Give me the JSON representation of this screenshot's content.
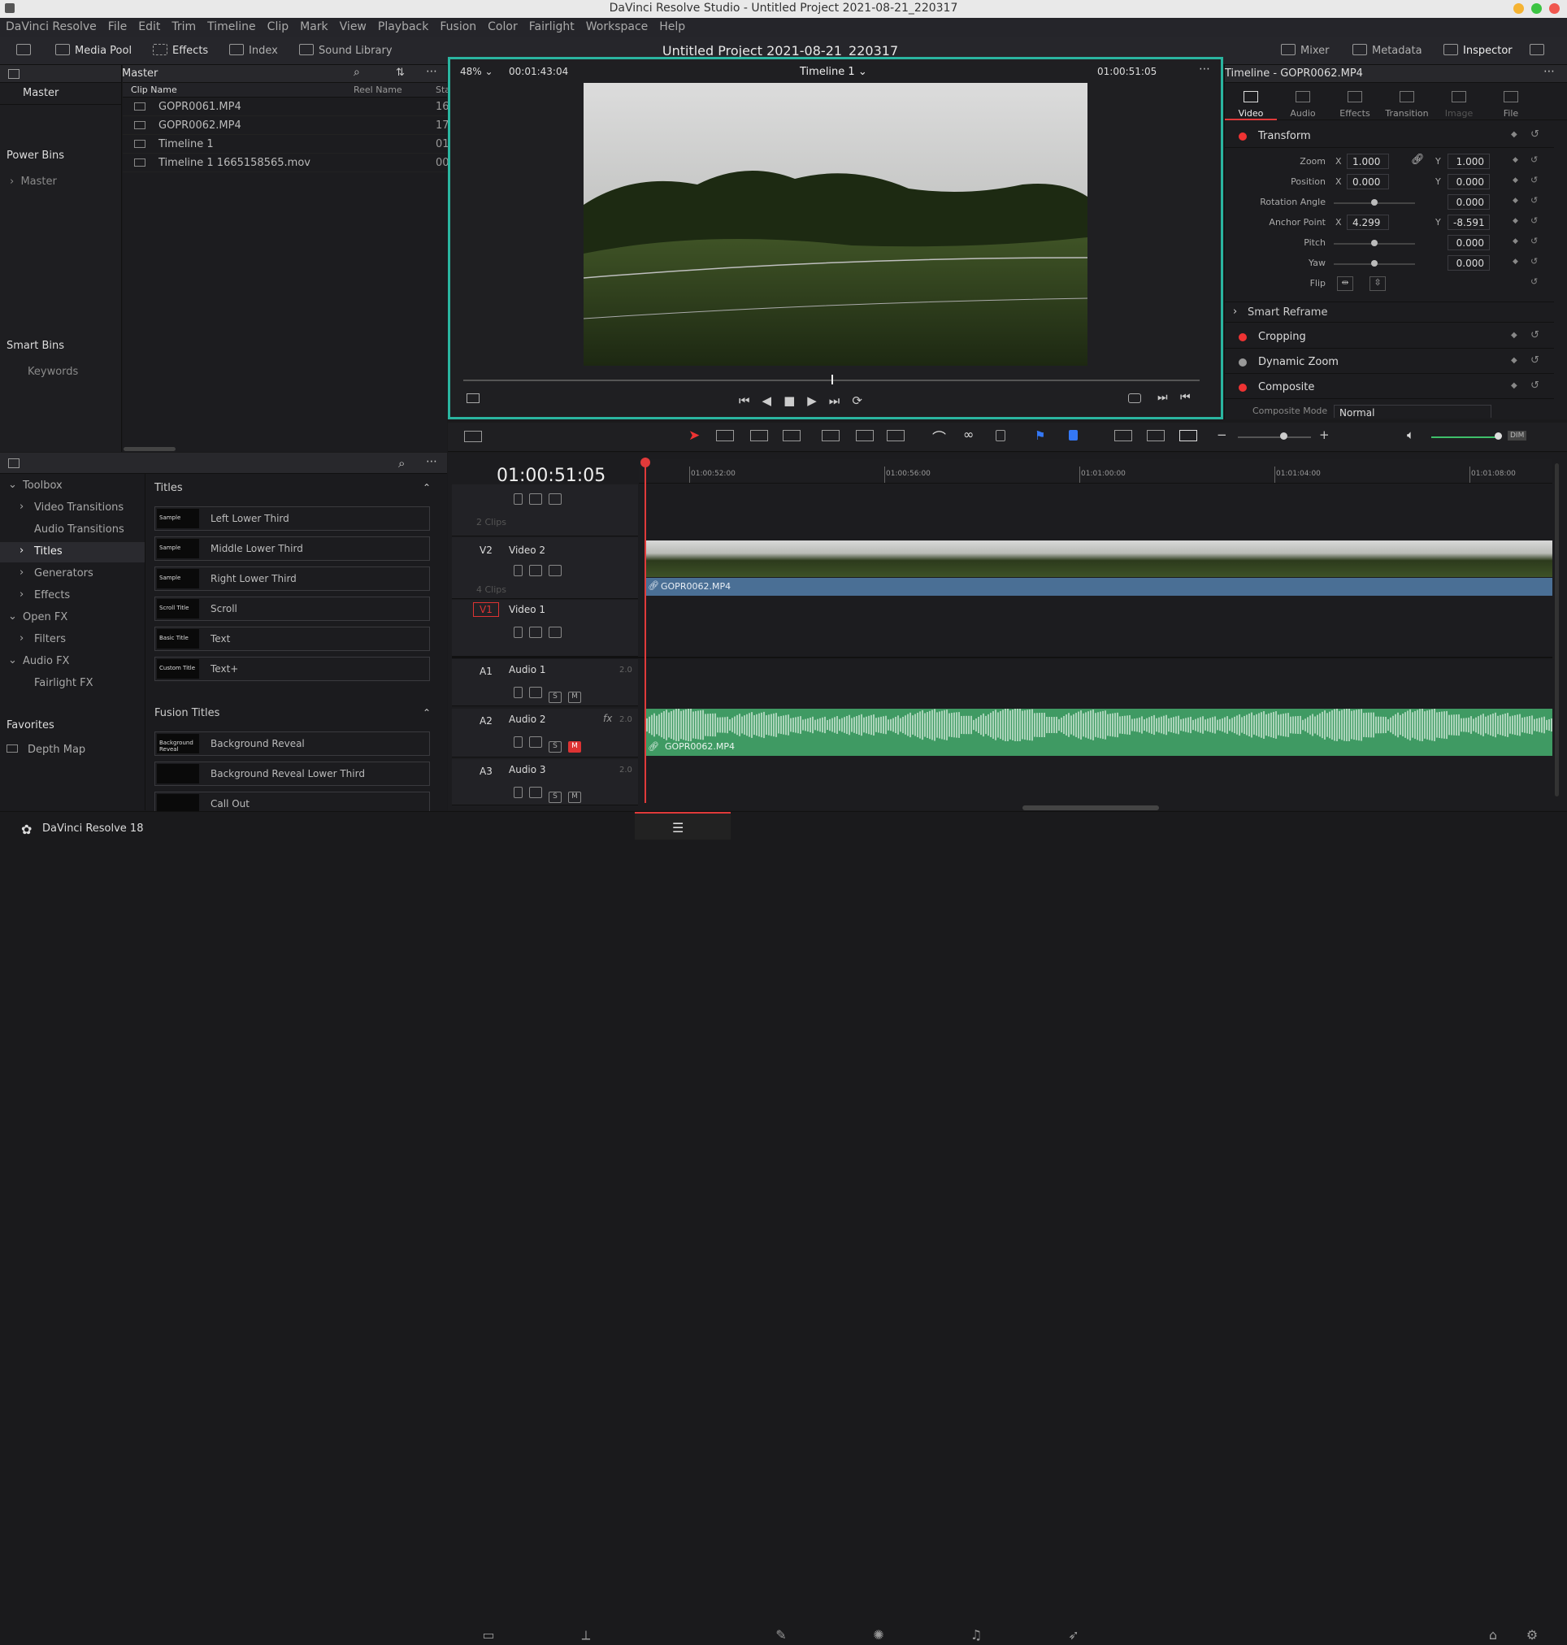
{
  "window": {
    "title": "DaVinci Resolve Studio - Untitled Project 2021-08-21_220317"
  },
  "menu": [
    "DaVinci Resolve",
    "File",
    "Edit",
    "Trim",
    "Timeline",
    "Clip",
    "Mark",
    "View",
    "Playback",
    "Fusion",
    "Color",
    "Fairlight",
    "Workspace",
    "Help"
  ],
  "toolbar": {
    "media_pool": "Media Pool",
    "effects": "Effects",
    "index": "Index",
    "sound_library": "Sound Library",
    "project_title": "Untitled Project 2021-08-21_220317",
    "mixer": "Mixer",
    "metadata": "Metadata",
    "inspector": "Inspector"
  },
  "bins": {
    "header": "Master",
    "master": "Master",
    "power_bins": "Power Bins",
    "power_master": "Master",
    "smart_bins": "Smart Bins",
    "keywords": "Keywords"
  },
  "clip_list": {
    "col_name": "Clip Name",
    "col_reel": "Reel Name",
    "col_start": "Sta",
    "clips": [
      {
        "name": "GOPR0061.MP4",
        "start": "16"
      },
      {
        "name": "GOPR0062.MP4",
        "start": "17"
      },
      {
        "name": "Timeline 1",
        "start": "01"
      },
      {
        "name": "Timeline 1 1665158565.mov",
        "start": "00"
      }
    ]
  },
  "effects_tree": {
    "items": [
      "Toolbox",
      "Video Transitions",
      "Audio Transitions",
      "Titles",
      "Generators",
      "Effects",
      "Open FX",
      "Filters",
      "Audio FX",
      "Fairlight FX"
    ],
    "favorites": "Favorites",
    "fav_item": "Depth Map"
  },
  "titles": {
    "header": "Titles",
    "items": [
      {
        "label": "Left Lower Third",
        "thumb": "Sample"
      },
      {
        "label": "Middle Lower Third",
        "thumb": "Sample"
      },
      {
        "label": "Right Lower Third",
        "thumb": "Sample"
      },
      {
        "label": "Scroll",
        "thumb": "Scroll Title"
      },
      {
        "label": "Text",
        "thumb": "Basic Title"
      },
      {
        "label": "Text+",
        "thumb": "Custom Title"
      }
    ],
    "fusion_header": "Fusion Titles",
    "fusion_items": [
      {
        "label": "Background Reveal",
        "thumb": "Background Reveal"
      },
      {
        "label": "Background Reveal Lower Third",
        "thumb": ""
      },
      {
        "label": "Call Out",
        "thumb": ""
      }
    ]
  },
  "viewer": {
    "zoom": "48%",
    "source_tc": "00:01:43:04",
    "timeline_name": "Timeline 1",
    "record_tc": "01:00:51:05"
  },
  "inspector": {
    "title": "Timeline - GOPR0062.MP4",
    "tabs": [
      "Video",
      "Audio",
      "Effects",
      "Transition",
      "Image",
      "File"
    ],
    "transform": "Transform",
    "zoom_label": "Zoom",
    "zoom_x": "1.000",
    "zoom_y": "1.000",
    "position_label": "Position",
    "pos_x": "0.000",
    "pos_y": "0.000",
    "rotation_label": "Rotation Angle",
    "rotation": "0.000",
    "anchor_label": "Anchor Point",
    "anchor_x": "4.299",
    "anchor_y": "-8.591",
    "pitch_label": "Pitch",
    "pitch": "0.000",
    "yaw_label": "Yaw",
    "yaw": "0.000",
    "flip_label": "Flip",
    "smart_reframe": "Smart Reframe",
    "cropping": "Cropping",
    "dynamic_zoom": "Dynamic Zoom",
    "composite": "Composite",
    "composite_mode_label": "Composite Mode",
    "composite_mode": "Normal",
    "x": "X",
    "y": "Y"
  },
  "timeline": {
    "timecode": "01:00:51:05",
    "ruler": [
      "01:00:52:00",
      "01:00:56:00",
      "01:01:00:00",
      "01:01:04:00",
      "01:01:08:00"
    ],
    "tracks": {
      "v3_clips": "2 Clips",
      "v2_id": "V2",
      "v2_name": "Video 2",
      "v2_clips": "4 Clips",
      "v1_id": "V1",
      "v1_name": "Video 1",
      "a1_id": "A1",
      "a1_name": "Audio 1",
      "a1_ch": "2.0",
      "a2_id": "A2",
      "a2_name": "Audio 2",
      "a2_ch": "2.0",
      "a2_fx": "fx",
      "a3_id": "A3",
      "a3_name": "Audio 3",
      "a3_ch": "2.0",
      "solo": "S",
      "mute": "M"
    },
    "video_clip": "GOPR0062.MP4",
    "audio_clip": "GOPR0062.MP4",
    "dim": "DIM"
  },
  "footer": {
    "app": "DaVinci Resolve 18"
  },
  "colors": {
    "accent": "#2ab5a0",
    "playhead": "#e03a3a",
    "audio": "#3f9a63",
    "video_bar": "#4a6f95"
  }
}
